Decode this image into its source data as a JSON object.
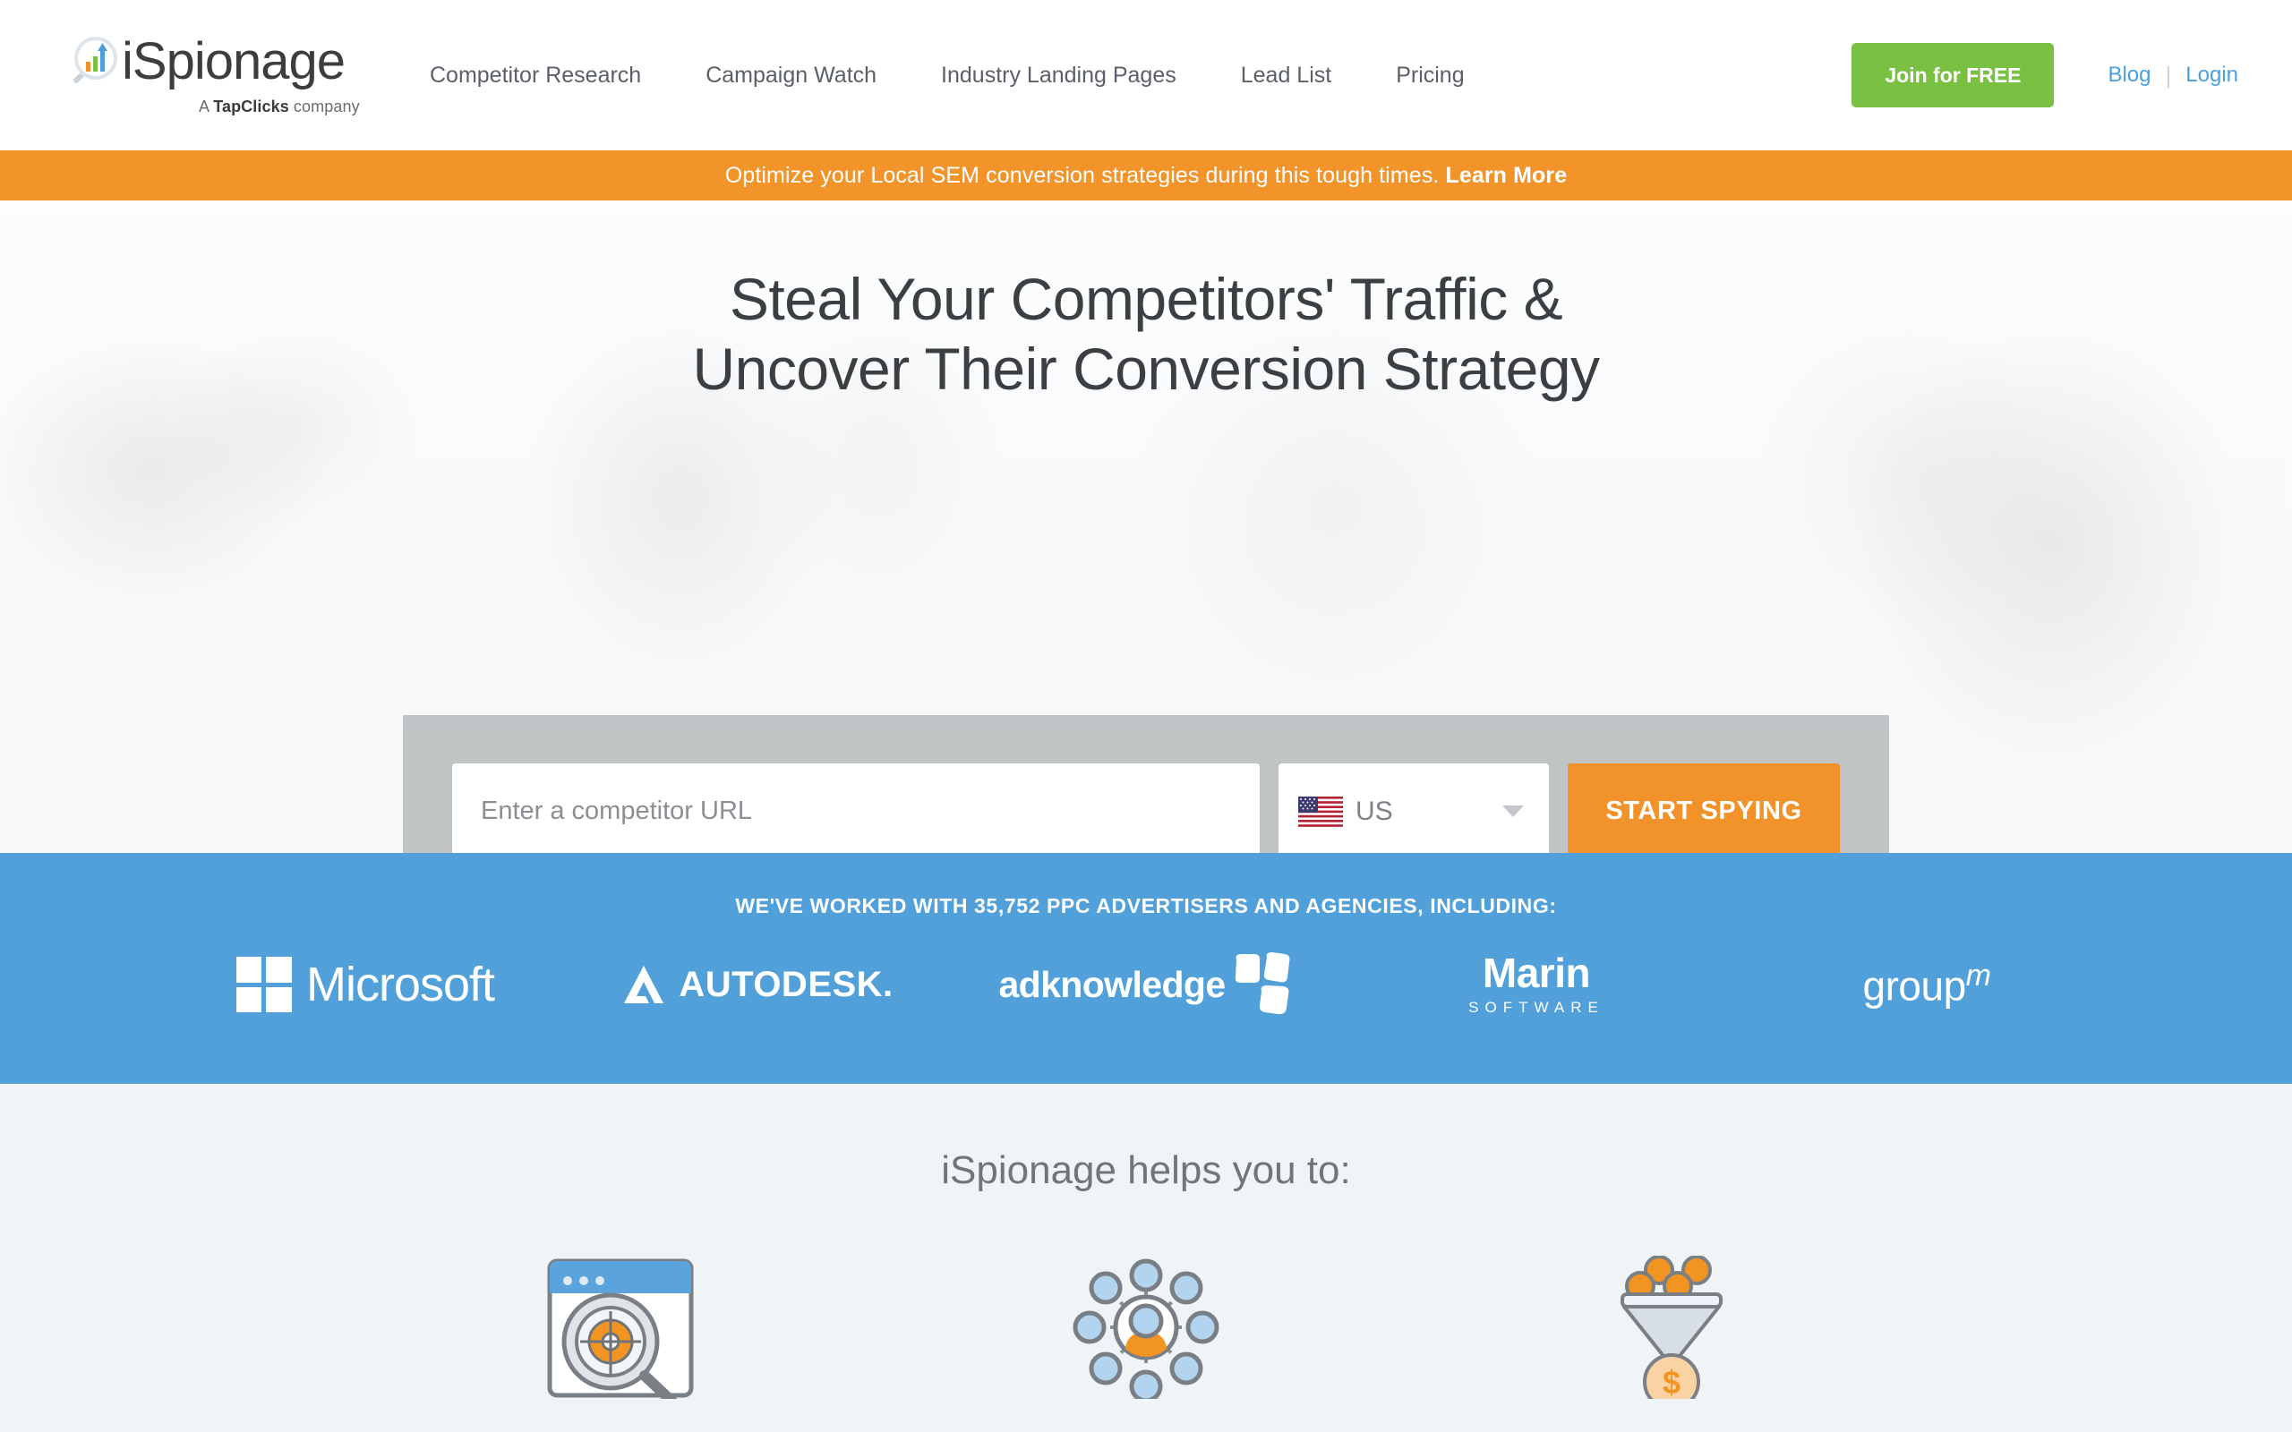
{
  "header": {
    "logo": {
      "wordmark": "iSpionage",
      "tagline_prefix": "A ",
      "tagline_brand": "TapClicks",
      "tagline_suffix": " company",
      "icon": "magnifier-barchart-logo"
    },
    "nav": [
      {
        "label": "Competitor Research"
      },
      {
        "label": "Campaign Watch"
      },
      {
        "label": "Industry Landing Pages"
      },
      {
        "label": "Lead List"
      },
      {
        "label": "Pricing"
      }
    ],
    "cta": {
      "label": "Join for FREE",
      "color": "#7ac143"
    },
    "blog_label": "Blog",
    "separator": "|",
    "login_label": "Login",
    "link_color": "#4a9fdc"
  },
  "promo": {
    "text": "Optimize your Local SEM conversion strategies during this tough times. ",
    "link_label": "Learn More",
    "background": "#f2942a"
  },
  "hero": {
    "title_line1": "Steal Your Competitors' Traffic &",
    "title_line2": "Uncover Their Conversion Strategy",
    "search": {
      "placeholder": "Enter a competitor URL",
      "value": "",
      "country_code": "US",
      "country_flag": "us-flag-icon",
      "submit_label": "START SPYING",
      "submit_color": "#f2922a"
    }
  },
  "clients": {
    "heading": "WE'VE WORKED WITH 35,752 PPC ADVERTISERS AND AGENCIES, INCLUDING:",
    "background": "#51a0da",
    "logos": [
      {
        "name": "Microsoft",
        "text": "Microsoft"
      },
      {
        "name": "Autodesk",
        "text": "AUTODESK."
      },
      {
        "name": "Adknowledge",
        "text": "adknowledge"
      },
      {
        "name": "Marin Software",
        "text": "Marin",
        "subtext": "SOFTWARE"
      },
      {
        "name": "GroupM",
        "text": "group",
        "superscript": "m"
      }
    ]
  },
  "helps": {
    "title": "iSpionage helps you to:",
    "features": [
      {
        "icon": "browser-target-search-icon"
      },
      {
        "icon": "audience-network-icon"
      },
      {
        "icon": "conversion-funnel-money-icon"
      }
    ]
  }
}
